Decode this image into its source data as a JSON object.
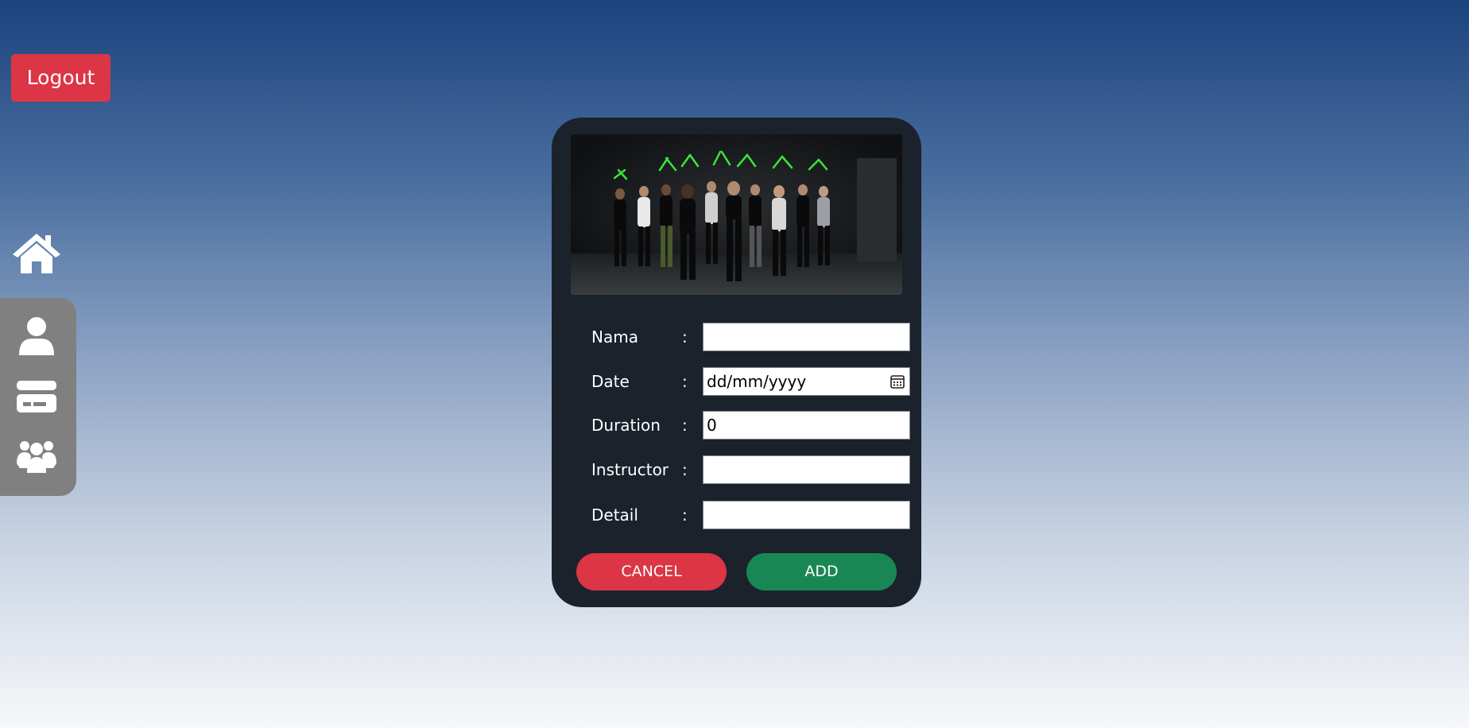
{
  "header": {
    "logout_label": "Logout"
  },
  "nav": {
    "items": [
      {
        "name": "home",
        "icon": "home-icon"
      },
      {
        "name": "profile",
        "icon": "user-icon"
      },
      {
        "name": "payment",
        "icon": "credit-card-icon"
      },
      {
        "name": "classes",
        "icon": "people-group-icon"
      }
    ]
  },
  "form": {
    "image": "group-fitness-class-photo",
    "fields": {
      "name": {
        "label": "Nama",
        "colon": ":",
        "value": ""
      },
      "date": {
        "label": "Date",
        "colon": ":",
        "value": "dd/mm/yyyy"
      },
      "duration": {
        "label": "Duration",
        "colon": ":",
        "value": "0"
      },
      "instructor": {
        "label": "Instructor",
        "colon": ":",
        "value": ""
      },
      "detail": {
        "label": "Detail",
        "colon": ":",
        "value": ""
      }
    },
    "cancel_label": "CANCEL",
    "add_label": "ADD"
  },
  "colors": {
    "danger": "#dc3545",
    "success": "#198754",
    "card_bg": "#1c222c",
    "sidebar_bg": "#808080"
  }
}
